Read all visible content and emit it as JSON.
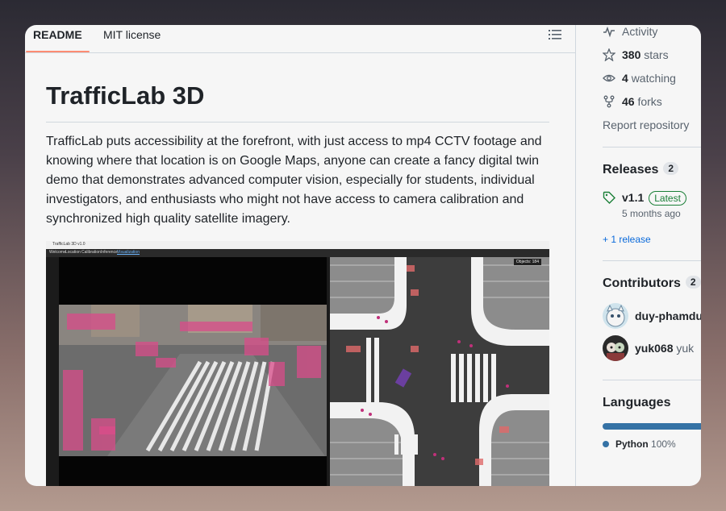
{
  "tabs": {
    "readme": "README",
    "license": "MIT license"
  },
  "readme": {
    "title": "TrafficLab 3D",
    "description": "TrafficLab puts accessibility at the forefront, with just access to mp4 CCTV footage and knowing where that location is on Google Maps, anyone can create a fancy digital twin demo that demonstrates advanced computer vision, especially for students, individual investigators, and enthusiasts who might not have access to camera calibration and synchronized high quality satellite imagery."
  },
  "app_screenshot": {
    "window_title": "TrafficLab 3D v1.0",
    "menu": [
      "Welcome",
      "Location",
      "Calibration",
      "Inference",
      "Visualization"
    ],
    "objects_label": "Objects: 184"
  },
  "sidebar": {
    "activity": "Activity",
    "stars_count": "380",
    "stars_label": "stars",
    "watching_count": "4",
    "watching_label": "watching",
    "forks_count": "46",
    "forks_label": "forks",
    "report": "Report repository",
    "releases_title": "Releases",
    "releases_count": "2",
    "release_version": "v1.1",
    "release_badge": "Latest",
    "release_time": "5 months ago",
    "more_releases": "+ 1 release",
    "contributors_title": "Contributors",
    "contributors_count": "2",
    "contributors": [
      {
        "login": "duy-phamdu",
        "name": ""
      },
      {
        "login": "yuk068",
        "name": "yuk"
      }
    ],
    "languages_title": "Languages",
    "language_name": "Python",
    "language_percent": "100%"
  },
  "colors": {
    "accent_tab": "#fd8c73",
    "link": "#0969da",
    "python": "#3572A5",
    "latest_green": "#1a7f37"
  }
}
